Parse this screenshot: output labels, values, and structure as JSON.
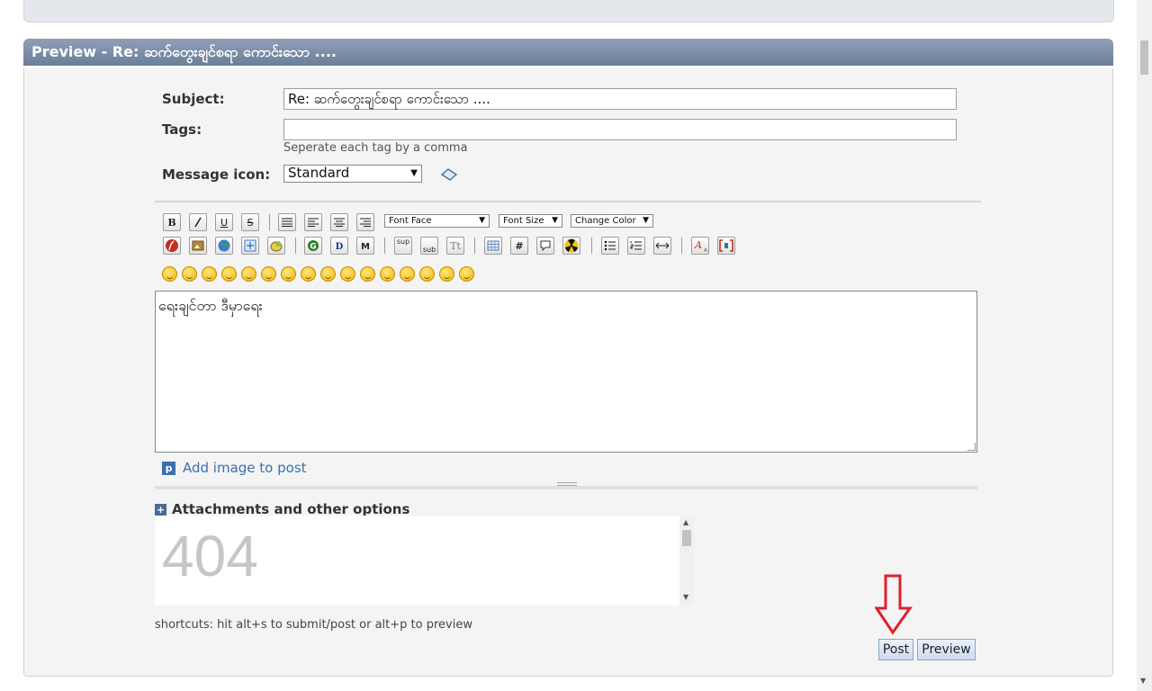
{
  "panel": {
    "title": "Preview - Re: ဆက်တွေးချင်စရာ ကောင်းသော ...."
  },
  "form": {
    "subject_label": "Subject:",
    "subject_value": "Re: ဆက်တွေးချင်စရာ ကောင်းသော ....",
    "tags_label": "Tags:",
    "tags_value": "",
    "tags_hint": "Seperate each tag by a comma",
    "icon_label": "Message icon:",
    "icon_selected": "Standard"
  },
  "toolbar": {
    "row1": [
      {
        "label": "B",
        "name": "bold-button"
      },
      {
        "label": "I",
        "name": "italic-button"
      },
      {
        "label": "U",
        "name": "underline-button"
      },
      {
        "label": "S",
        "name": "strikethrough-button"
      }
    ],
    "font_face": "Font Face",
    "font_size": "Font Size",
    "change_color": "Change Color",
    "sup": "sup",
    "sub": "sub",
    "tt": "Tt",
    "hash": "#"
  },
  "editor": {
    "content": "ရေးချင်တာ ဒီမှာရေး"
  },
  "add_image": "Add image to post",
  "attachments": {
    "label": "Attachments and other options",
    "frame_text": "404"
  },
  "shortcuts": "shortcuts: hit alt+s to submit/post or alt+p to preview",
  "buttons": {
    "post": "Post",
    "preview": "Preview"
  },
  "colors": {
    "header": "#7a8ca6",
    "accent_link": "#3a6fb0",
    "annotation": "#e0202a"
  }
}
